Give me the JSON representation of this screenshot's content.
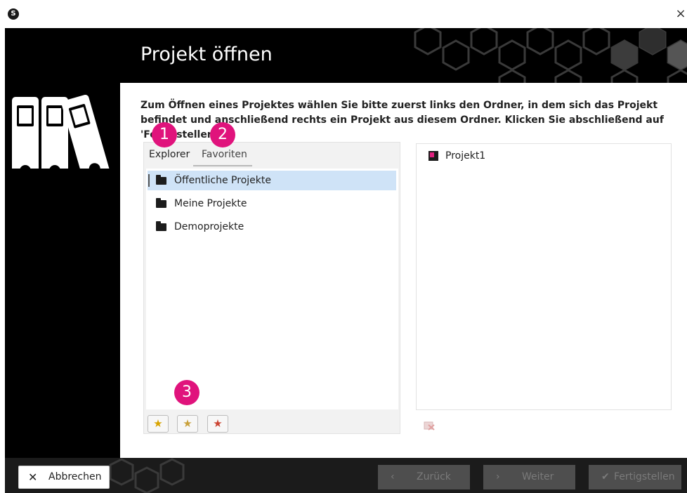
{
  "window": {
    "logo_text": "S",
    "close_glyph": "×"
  },
  "header": {
    "title": "Projekt öffnen"
  },
  "description": "Zum Öffnen eines Projektes wählen Sie bitte zuerst links den Ordner, in dem sich das Projekt befindet und anschließend rechts ein Projekt aus diesem Ordner. Klicken Sie abschließend auf 'Fertigstellen'.",
  "tabs": [
    {
      "label": "Explorer",
      "active": true
    },
    {
      "label": "Favoriten",
      "active": false
    }
  ],
  "folders": [
    {
      "label": "Öffentliche Projekte",
      "selected": true,
      "icon": "folder-open-icon"
    },
    {
      "label": "Meine Projekte",
      "selected": false,
      "icon": "folder-open-icon"
    },
    {
      "label": "Demoprojekte",
      "selected": false,
      "icon": "folder-open-icon"
    }
  ],
  "favorite_buttons": [
    {
      "icon": "star-add-icon",
      "glyph": "★"
    },
    {
      "icon": "star-edit-icon",
      "glyph": "★"
    },
    {
      "icon": "star-remove-icon",
      "glyph": "★"
    }
  ],
  "projects": [
    {
      "label": "Projekt1",
      "icon": "project-icon"
    }
  ],
  "badges": [
    "1",
    "2",
    "3"
  ],
  "footer": {
    "cancel": {
      "label": "Abbrechen",
      "glyph": "✕"
    },
    "back": {
      "label": "Zurück",
      "glyph": "‹",
      "enabled": false
    },
    "next": {
      "label": "Weiter",
      "glyph": "›",
      "enabled": false
    },
    "finish": {
      "label": "Fertigstellen",
      "glyph": "✔",
      "enabled": false
    }
  },
  "colors": {
    "accent": "#e0137c",
    "selection": "#cfe3f7",
    "frame": "#000000"
  }
}
